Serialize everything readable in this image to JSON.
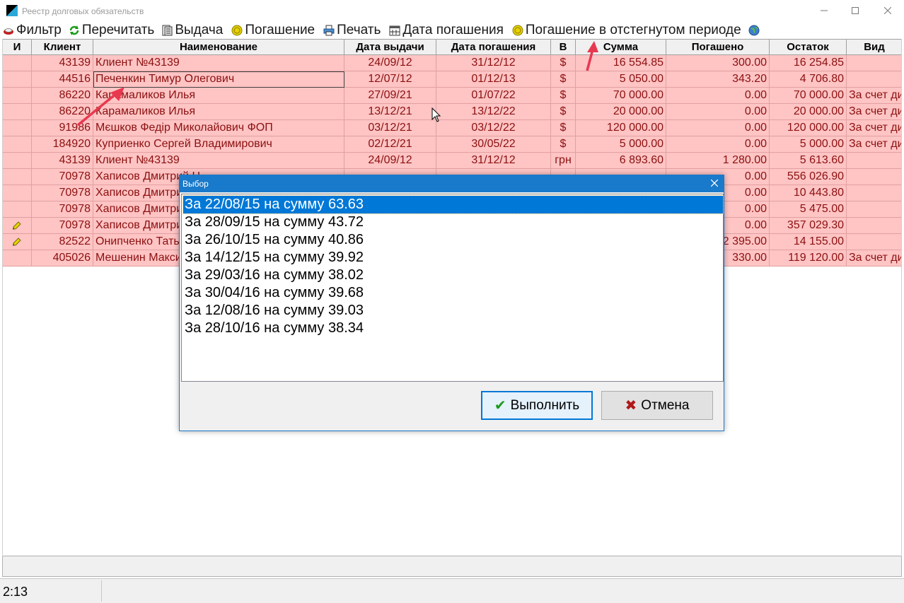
{
  "window": {
    "title": "Реестр долговых обязательств"
  },
  "toolbar": {
    "items": [
      {
        "label": "Фильтр",
        "icon": "filter-icon"
      },
      {
        "label": "Перечитать",
        "icon": "refresh-icon"
      },
      {
        "label": "Выдача",
        "icon": "clipboard-icon"
      },
      {
        "label": "Погашение",
        "icon": "coin-icon"
      },
      {
        "label": "Печать",
        "icon": "printer-icon"
      },
      {
        "label": "Дата погашения",
        "icon": "calendar-icon"
      },
      {
        "label": "Погашение в отстегнутом периоде",
        "icon": "coin-icon"
      }
    ]
  },
  "grid": {
    "headers": [
      "И",
      "Клиент",
      "Наименование",
      "Дата выдачи",
      "Дата погашения",
      "В",
      "Сумма",
      "Погашено",
      "Остаток",
      "Вид"
    ],
    "rows": [
      {
        "i": "",
        "client": "43139",
        "name": "Клиент №43139",
        "issued": "24/09/12",
        "due": "31/12/12",
        "cur": "$",
        "sum": "16 554.85",
        "paid": "300.00",
        "rest": "16 254.85",
        "kind": ""
      },
      {
        "i": "",
        "client": "44516",
        "name": "Печенкин Тимур Олегович",
        "issued": "12/07/12",
        "due": "01/12/13",
        "cur": "$",
        "sum": "5 050.00",
        "paid": "343.20",
        "rest": "4 706.80",
        "kind": ""
      },
      {
        "i": "",
        "client": "86220",
        "name": "Карамаликов Илья",
        "issued": "27/09/21",
        "due": "01/07/22",
        "cur": "$",
        "sum": "70 000.00",
        "paid": "0.00",
        "rest": "70 000.00",
        "kind": "За счет ди"
      },
      {
        "i": "",
        "client": "86220",
        "name": "Карамаликов Илья",
        "issued": "13/12/21",
        "due": "13/12/22",
        "cur": "$",
        "sum": "20 000.00",
        "paid": "0.00",
        "rest": "20 000.00",
        "kind": "За счет ди"
      },
      {
        "i": "",
        "client": "91986",
        "name": "Мєшков Федір Миколайович ФОП",
        "issued": "03/12/21",
        "due": "03/12/22",
        "cur": "$",
        "sum": "120 000.00",
        "paid": "0.00",
        "rest": "120 000.00",
        "kind": "За счет ди"
      },
      {
        "i": "",
        "client": "184920",
        "name": "Куприенко Сергей Владимирович",
        "issued": "02/12/21",
        "due": "30/05/22",
        "cur": "$",
        "sum": "5 000.00",
        "paid": "0.00",
        "rest": "5 000.00",
        "kind": "За счет ди"
      },
      {
        "i": "",
        "client": "43139",
        "name": "Клиент №43139",
        "issued": "24/09/12",
        "due": "31/12/12",
        "cur": "грн",
        "sum": "6 893.60",
        "paid": "1 280.00",
        "rest": "5 613.60",
        "kind": ""
      },
      {
        "i": "",
        "client": "70978",
        "name": "Хаписов Дмитрий Н",
        "issued": "",
        "due": "",
        "cur": "",
        "sum": "",
        "paid": "0.00",
        "rest": "556 026.90",
        "kind": ""
      },
      {
        "i": "",
        "client": "70978",
        "name": "Хаписов Дмитрий",
        "issued": "",
        "due": "",
        "cur": "",
        "sum": "",
        "paid": "0.00",
        "rest": "10 443.80",
        "kind": ""
      },
      {
        "i": "",
        "client": "70978",
        "name": "Хаписов Дмитрий",
        "issued": "",
        "due": "",
        "cur": "",
        "sum": "",
        "paid": "0.00",
        "rest": "5 475.00",
        "kind": ""
      },
      {
        "i": "pencil",
        "client": "70978",
        "name": "Хаписов Дмитрий",
        "issued": "",
        "due": "",
        "cur": "",
        "sum": "",
        "paid": "0.00",
        "rest": "357 029.30",
        "kind": ""
      },
      {
        "i": "pencil",
        "client": "82522",
        "name": "Онипченко Тать",
        "issued": "",
        "due": "",
        "cur": "",
        "sum": "",
        "paid": "2 395.00",
        "rest": "14 155.00",
        "kind": ""
      },
      {
        "i": "",
        "client": "405026",
        "name": "Мешенин Макси",
        "issued": "",
        "due": "",
        "cur": "",
        "sum": "",
        "paid": "330.00",
        "rest": "119 120.00",
        "kind": "За счет ди"
      }
    ]
  },
  "statusbar": {
    "text": "2:13"
  },
  "dialog": {
    "title": "Выбор",
    "items": [
      "За 22/08/15 на сумму 63.63",
      "За 28/09/15 на сумму 43.72",
      "За 26/10/15 на сумму 40.86",
      "За 14/12/15 на сумму 39.92",
      "За 29/03/16 на сумму 38.02",
      "За 30/04/16 на сумму 39.68",
      "За 12/08/16 на сумму 39.03",
      "За 28/10/16 на сумму 38.34"
    ],
    "ok_label": "Выполнить",
    "cancel_label": "Отмена"
  },
  "colors": {
    "row_bg": "#ffc4c4",
    "row_text": "#8b1010",
    "dialog_accent": "#1979ca",
    "selection": "#0078d7",
    "arrow": "#e8384f"
  }
}
